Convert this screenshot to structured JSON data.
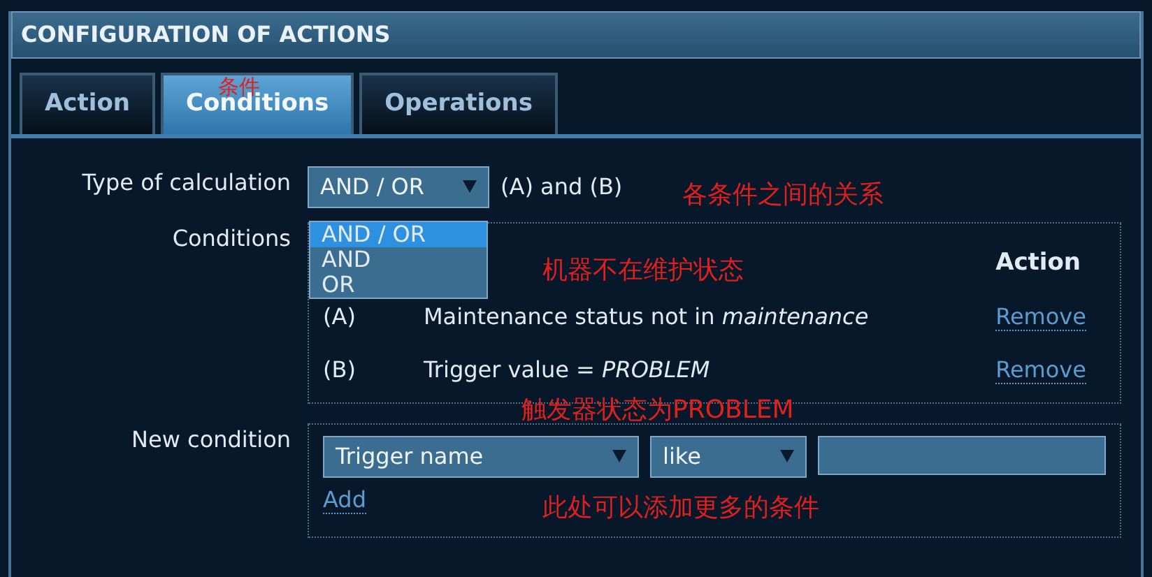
{
  "header": {
    "title": "CONFIGURATION OF ACTIONS"
  },
  "tabs": [
    {
      "label": "Action",
      "selected": false
    },
    {
      "label": "Conditions",
      "selected": true
    },
    {
      "label": "Operations",
      "selected": false
    }
  ],
  "calculation": {
    "label": "Type of calculation",
    "value": "AND / OR",
    "formula": "(A) and (B)",
    "options": [
      {
        "label": "AND / OR",
        "selected": true
      },
      {
        "label": "AND",
        "selected": false
      },
      {
        "label": "OR",
        "selected": false
      }
    ]
  },
  "conditions": {
    "label": "Conditions",
    "action_header": "Action",
    "rows": [
      {
        "label": "(A)",
        "name": "Maintenance status not in *maintenance*",
        "action": "Remove"
      },
      {
        "label": "(B)",
        "name": "Trigger value = *PROBLEM*",
        "action": "Remove"
      }
    ]
  },
  "new_condition": {
    "label": "New condition",
    "type": "Trigger name",
    "operator": "like",
    "add": "Add"
  },
  "annotations": [
    {
      "text": "条件"
    },
    {
      "text": "各条件之间的关系"
    },
    {
      "text": "机器不在维护状态"
    },
    {
      "text": "触发器状态为PROBLEM"
    },
    {
      "text": "此处可以添加更多的条件"
    }
  ]
}
